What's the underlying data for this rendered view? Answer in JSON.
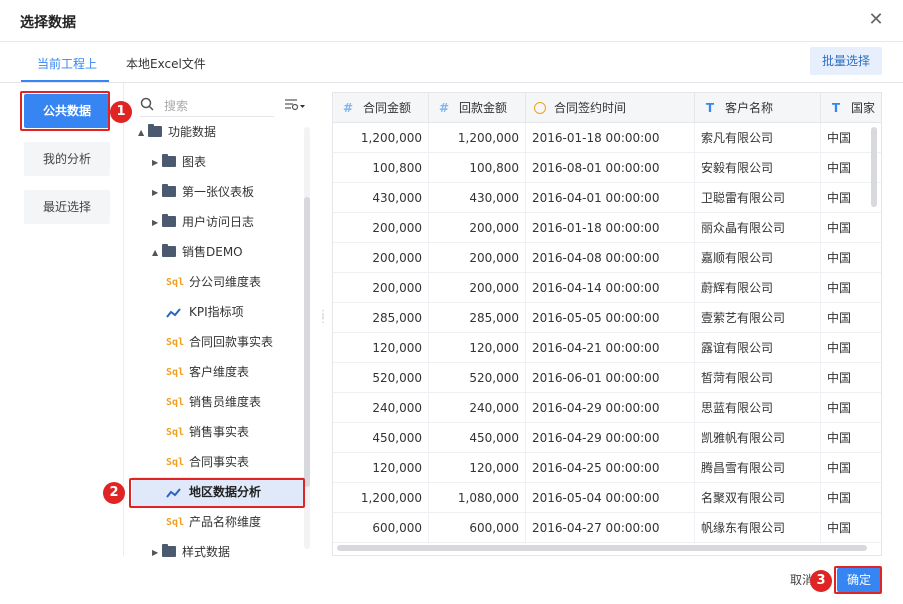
{
  "dialog": {
    "title": "选择数据"
  },
  "tabs": [
    {
      "label": "当前工程上"
    },
    {
      "label": "本地Excel文件"
    }
  ],
  "batch_select": "批量选择",
  "nav": [
    {
      "label": "公共数据"
    },
    {
      "label": "我的分析"
    },
    {
      "label": "最近选择"
    }
  ],
  "search": {
    "placeholder": "搜索"
  },
  "tree": [
    {
      "label": "功能数据"
    },
    {
      "label": "图表"
    },
    {
      "label": "第一张仪表板"
    },
    {
      "label": "用户访问日志"
    },
    {
      "label": "销售DEMO"
    },
    {
      "label": "分公司维度表"
    },
    {
      "label": "KPI指标项"
    },
    {
      "label": "合同回款事实表"
    },
    {
      "label": "客户维度表"
    },
    {
      "label": "销售员维度表"
    },
    {
      "label": "销售事实表"
    },
    {
      "label": "合同事实表"
    },
    {
      "label": "地区数据分析"
    },
    {
      "label": "产品名称维度"
    },
    {
      "label": "样式数据"
    }
  ],
  "table": {
    "columns": [
      "合同金额",
      "回款金额",
      "合同签约时间",
      "客户名称",
      "国家"
    ],
    "rows": [
      [
        "1,200,000",
        "1,200,000",
        "2016-01-18 00:00:00",
        "索凡有限公司",
        "中国"
      ],
      [
        "100,800",
        "100,800",
        "2016-08-01 00:00:00",
        "安毅有限公司",
        "中国"
      ],
      [
        "430,000",
        "430,000",
        "2016-04-01 00:00:00",
        "卫聪雷有限公司",
        "中国"
      ],
      [
        "200,000",
        "200,000",
        "2016-01-18 00:00:00",
        "丽众晶有限公司",
        "中国"
      ],
      [
        "200,000",
        "200,000",
        "2016-04-08 00:00:00",
        "嘉顺有限公司",
        "中国"
      ],
      [
        "200,000",
        "200,000",
        "2016-04-14 00:00:00",
        "蔚辉有限公司",
        "中国"
      ],
      [
        "285,000",
        "285,000",
        "2016-05-05 00:00:00",
        "壹萦艺有限公司",
        "中国"
      ],
      [
        "120,000",
        "120,000",
        "2016-04-21 00:00:00",
        "露谊有限公司",
        "中国"
      ],
      [
        "520,000",
        "520,000",
        "2016-06-01 00:00:00",
        "皙菏有限公司",
        "中国"
      ],
      [
        "240,000",
        "240,000",
        "2016-04-29 00:00:00",
        "思蓝有限公司",
        "中国"
      ],
      [
        "450,000",
        "450,000",
        "2016-04-29 00:00:00",
        "凯雅帆有限公司",
        "中国"
      ],
      [
        "120,000",
        "120,000",
        "2016-04-25 00:00:00",
        "腾昌雪有限公司",
        "中国"
      ],
      [
        "1,200,000",
        "1,080,000",
        "2016-05-04 00:00:00",
        "名聚双有限公司",
        "中国"
      ],
      [
        "600,000",
        "600,000",
        "2016-04-27 00:00:00",
        "帆缘东有限公司",
        "中国"
      ]
    ]
  },
  "footer": {
    "cancel": "取消",
    "ok": "确定"
  },
  "badges": [
    "1",
    "2",
    "3"
  ]
}
